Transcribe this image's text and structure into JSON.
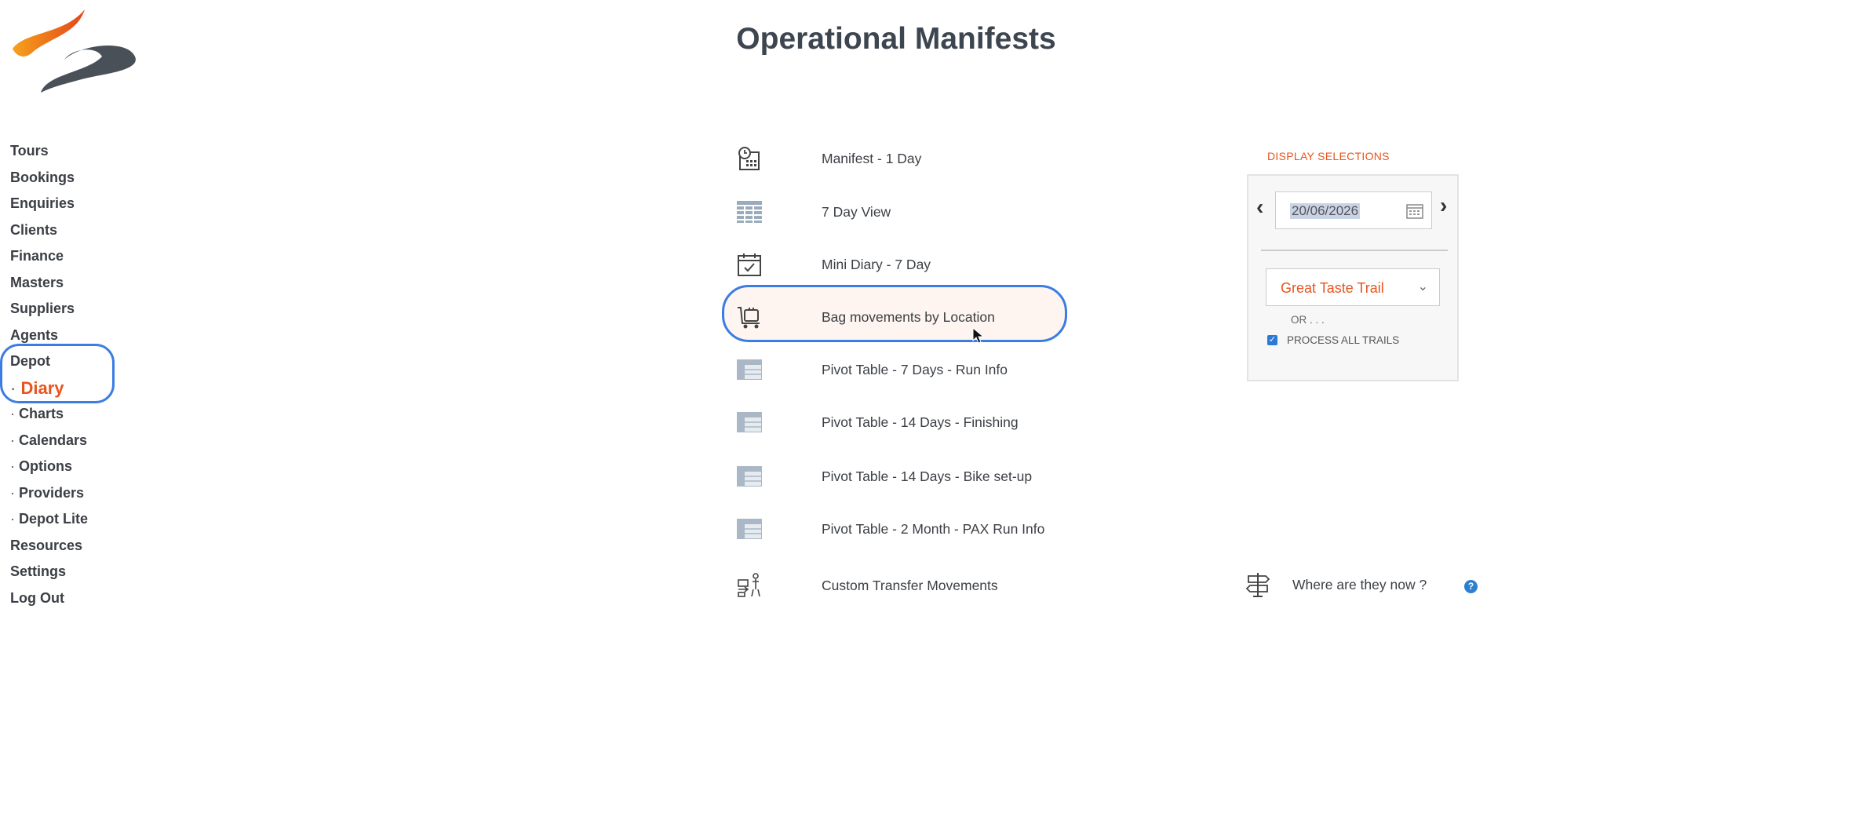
{
  "header": {
    "title": "Operational Manifests"
  },
  "sidebar": {
    "items": [
      {
        "label": "Tours"
      },
      {
        "label": "Bookings"
      },
      {
        "label": "Enquiries"
      },
      {
        "label": "Clients"
      },
      {
        "label": "Finance"
      },
      {
        "label": "Masters"
      },
      {
        "label": "Suppliers"
      },
      {
        "label": "Agents"
      },
      {
        "label": "Depot"
      },
      {
        "label": "Diary",
        "active": true
      },
      {
        "label": "Charts"
      },
      {
        "label": "Calendars"
      },
      {
        "label": "Options"
      },
      {
        "label": "Providers"
      },
      {
        "label": "Depot Lite"
      },
      {
        "label": "Resources"
      },
      {
        "label": "Settings"
      },
      {
        "label": "Log Out"
      }
    ]
  },
  "manifests": {
    "items": [
      {
        "label": "Manifest - 1 Day",
        "icon": "calendar-clock-icon"
      },
      {
        "label": "7 Day View",
        "icon": "grid-table-icon"
      },
      {
        "label": "Mini Diary - 7 Day",
        "icon": "calendar-check-icon"
      },
      {
        "label": "Bag movements by Location",
        "icon": "luggage-cart-icon"
      },
      {
        "label": "Pivot Table - 7 Days - Run Info",
        "icon": "pivot-table-icon"
      },
      {
        "label": "Pivot Table - 14 Days - Finishing",
        "icon": "pivot-table-icon"
      },
      {
        "label": "Pivot Table - 14 Days - Bike set-up",
        "icon": "pivot-table-icon"
      },
      {
        "label": "Pivot Table - 2 Month - PAX Run Info",
        "icon": "pivot-table-icon"
      },
      {
        "label": "Custom Transfer Movements",
        "icon": "transfer-person-icon"
      }
    ]
  },
  "display_selections": {
    "title": "DISPLAY SELECTIONS",
    "date": "20/06/2026",
    "trail": "Great Taste Trail",
    "or_text": "OR . . .",
    "process_all_label": "PROCESS ALL TRAILS",
    "process_all_checked": true
  },
  "where": {
    "label": "Where are they now ?",
    "help": "?"
  },
  "colors": {
    "accent": "#e8541e",
    "highlight": "#3b7de3",
    "text": "#3b3f45"
  }
}
